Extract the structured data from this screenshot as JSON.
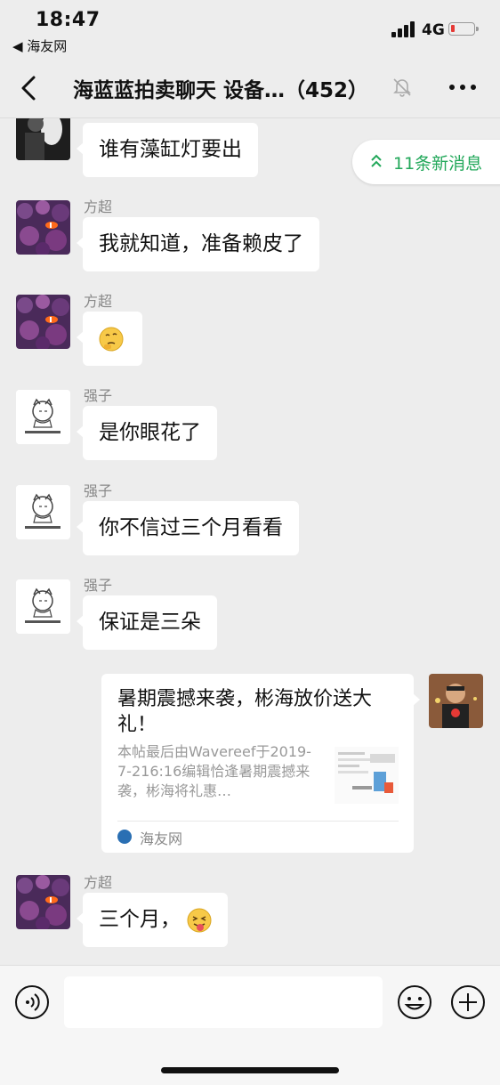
{
  "status_bar": {
    "time": "18:47",
    "back_app": "◀ 海友网",
    "network": "4G",
    "battery_level": 0.15
  },
  "nav": {
    "title": "海蓝蓝拍卖聊天  设备…（452）",
    "icons": [
      "back-chevron-icon",
      "mute-bell-icon",
      "more-dots-icon"
    ]
  },
  "new_messages": {
    "label": "11条新消息"
  },
  "messages": [
    {
      "text": "谁有藻缸灯要出"
    },
    {
      "sender": "方超",
      "text": "我就知道，准备赖皮了"
    },
    {
      "sender": "方超",
      "emoji": "thinking-face"
    },
    {
      "sender": "强子",
      "text": "是你眼花了"
    },
    {
      "sender": "强子",
      "text": "你不信过三个月看看"
    },
    {
      "sender": "强子",
      "text": "保证是三朵"
    },
    {
      "sender": "方超",
      "text": "三个月，",
      "emoji": "tongue-face"
    }
  ],
  "link_card": {
    "title": "暑期震撼来袭，彬海放价送大礼！",
    "description": "本帖最后由Wavereef于2019-7-216:16编辑恰逢暑期震撼来袭，彬海将礼惠…",
    "source": "海友网"
  },
  "colors": {
    "background": "#ededed",
    "bubble": "#ffffff",
    "accent_green": "#22a85a",
    "battery_low": "#e53935"
  }
}
